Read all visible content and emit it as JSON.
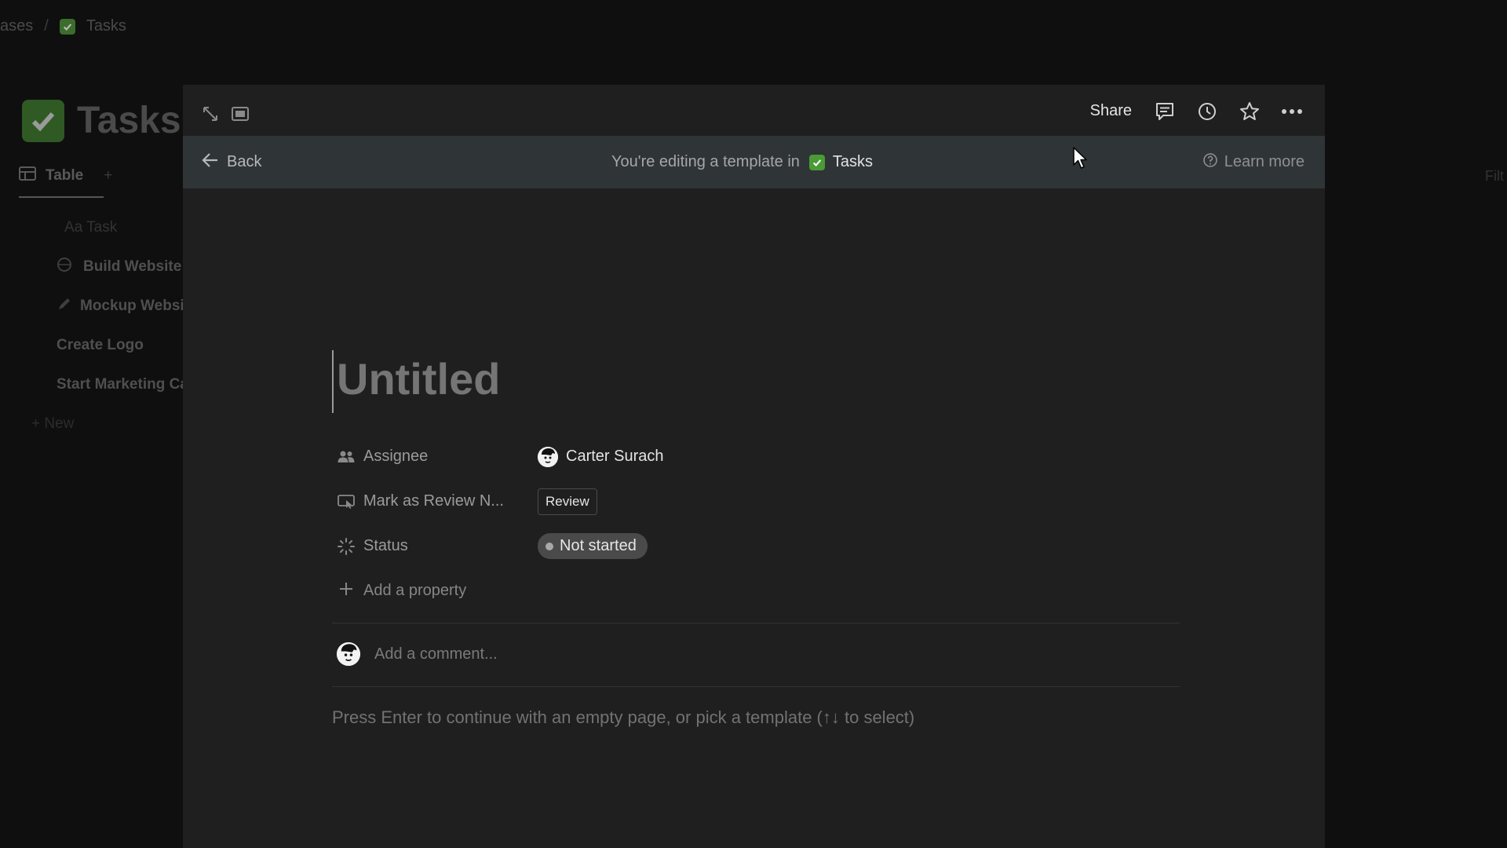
{
  "background": {
    "breadcrumb": [
      "ases",
      "Tasks"
    ],
    "title": "Tasks",
    "tab_label": "Table",
    "tab_add": "+",
    "column_header": "Aa Task",
    "rows": [
      "Build Website",
      "Mockup Website",
      "Create Logo",
      "Start Marketing Campaign"
    ],
    "new_label": "+ New",
    "right_text": "Filt"
  },
  "modal": {
    "topbar": {
      "share_label": "Share",
      "icons": [
        "expand-icon",
        "peek-mode-icon",
        "comment-icon",
        "history-icon",
        "star-icon",
        "more-icon"
      ]
    },
    "banner": {
      "back_label": "Back",
      "editing_text": "You're editing a template in",
      "database_label": "Tasks",
      "learn_more_label": "Learn more"
    },
    "page": {
      "title_placeholder": "Untitled",
      "properties": [
        {
          "label": "Assignee",
          "value": "Carter Surach"
        },
        {
          "label": "Mark as Review N...",
          "value": "Review"
        },
        {
          "label": "Status",
          "value": "Not started"
        }
      ],
      "add_property_label": "Add a property",
      "comment_placeholder": "Add a comment...",
      "hint": "Press Enter to continue with an empty page, or pick a template (↑↓ to select)"
    }
  },
  "colors": {
    "modal_bg": "#1f1f1f",
    "banner_bg": "#2f3437",
    "check_green": "#3b6d2c",
    "status_pill_bg": "#4a4a4a"
  }
}
